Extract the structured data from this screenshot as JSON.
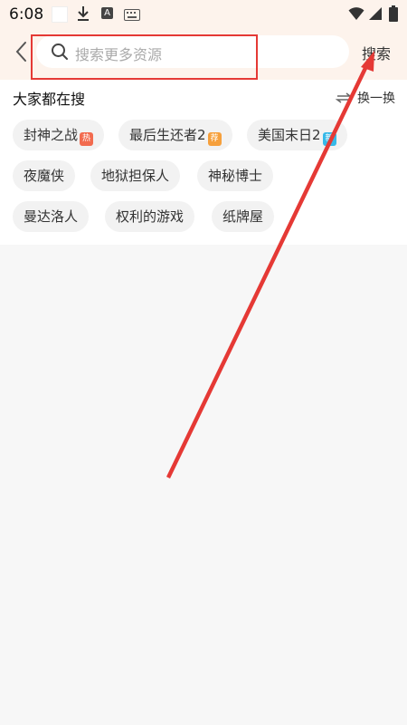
{
  "status_bar": {
    "time": "6:08"
  },
  "header": {
    "search": {
      "placeholder": "搜索更多资源"
    },
    "search_button_label": "搜索"
  },
  "hot_searches": {
    "title": "大家都在搜",
    "refresh_label": "换一换",
    "tags": [
      {
        "label": "封神之战",
        "badge": "热"
      },
      {
        "label": "最后生还者2",
        "badge": "荐"
      },
      {
        "label": "美国末日2",
        "badge": "新"
      },
      {
        "label": "夜魔侠",
        "badge": ""
      },
      {
        "label": "地狱担保人",
        "badge": ""
      },
      {
        "label": "神秘博士",
        "badge": ""
      },
      {
        "label": "曼达洛人",
        "badge": ""
      },
      {
        "label": "权利的游戏",
        "badge": ""
      },
      {
        "label": "纸牌屋",
        "badge": ""
      }
    ]
  },
  "colors": {
    "header_bg": "#fdf3ec",
    "annotation_red": "#e53935",
    "badge_hot": "#f26b4f",
    "badge_recommend": "#f6a03c",
    "badge_new": "#37b9e8"
  }
}
